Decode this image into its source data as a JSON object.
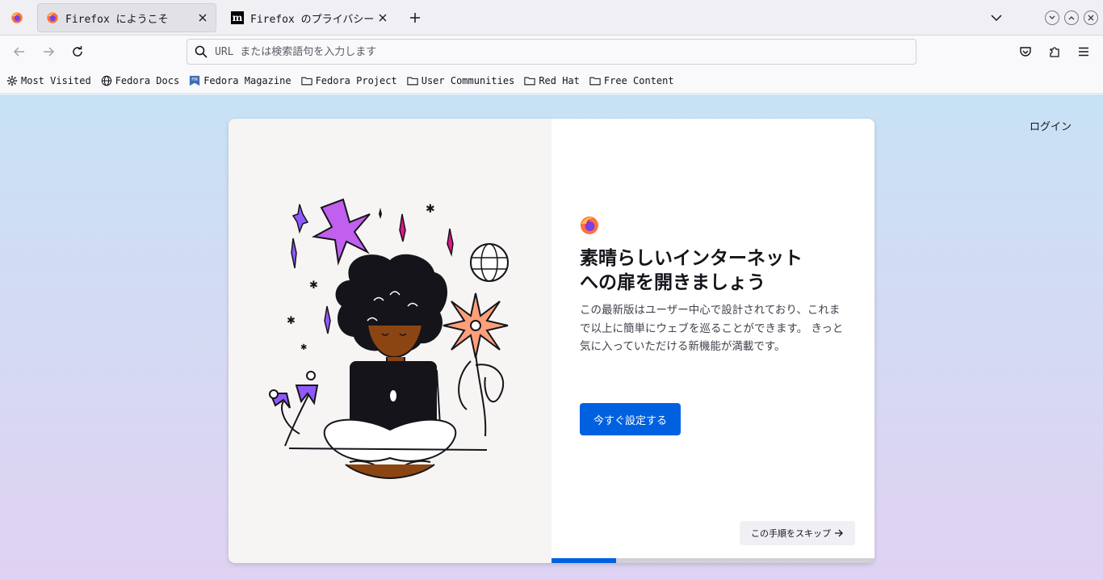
{
  "tabs": [
    {
      "title": "Firefox にようこそ",
      "active": true
    },
    {
      "title": "Firefox のプライバシーに関する通知",
      "active": false
    }
  ],
  "urlbar": {
    "placeholder": "URL または検索語句を入力します"
  },
  "bookmarks": [
    {
      "label": "Most Visited",
      "icon": "gear-icon"
    },
    {
      "label": "Fedora Docs",
      "icon": "globe-icon"
    },
    {
      "label": "Fedora Magazine",
      "icon": "fedora-magazine-icon"
    },
    {
      "label": "Fedora Project",
      "icon": "folder-icon"
    },
    {
      "label": "User Communities",
      "icon": "folder-icon"
    },
    {
      "label": "Red Hat",
      "icon": "folder-icon"
    },
    {
      "label": "Free Content",
      "icon": "folder-icon"
    }
  ],
  "page": {
    "login": "ログイン",
    "headline_line1": "素晴らしいインターネット",
    "headline_line2": "への扉を開きましょう",
    "body": "この最新版はユーザー中心で設計されており、これまで以上に簡単にウェブを巡ることができます。 きっと気に入っていただける新機能が満載です。",
    "primary_button": "今すぐ設定する",
    "skip_button": "この手順をスキップ",
    "progress": 0.2
  },
  "colors": {
    "accent": "#0061e0"
  }
}
